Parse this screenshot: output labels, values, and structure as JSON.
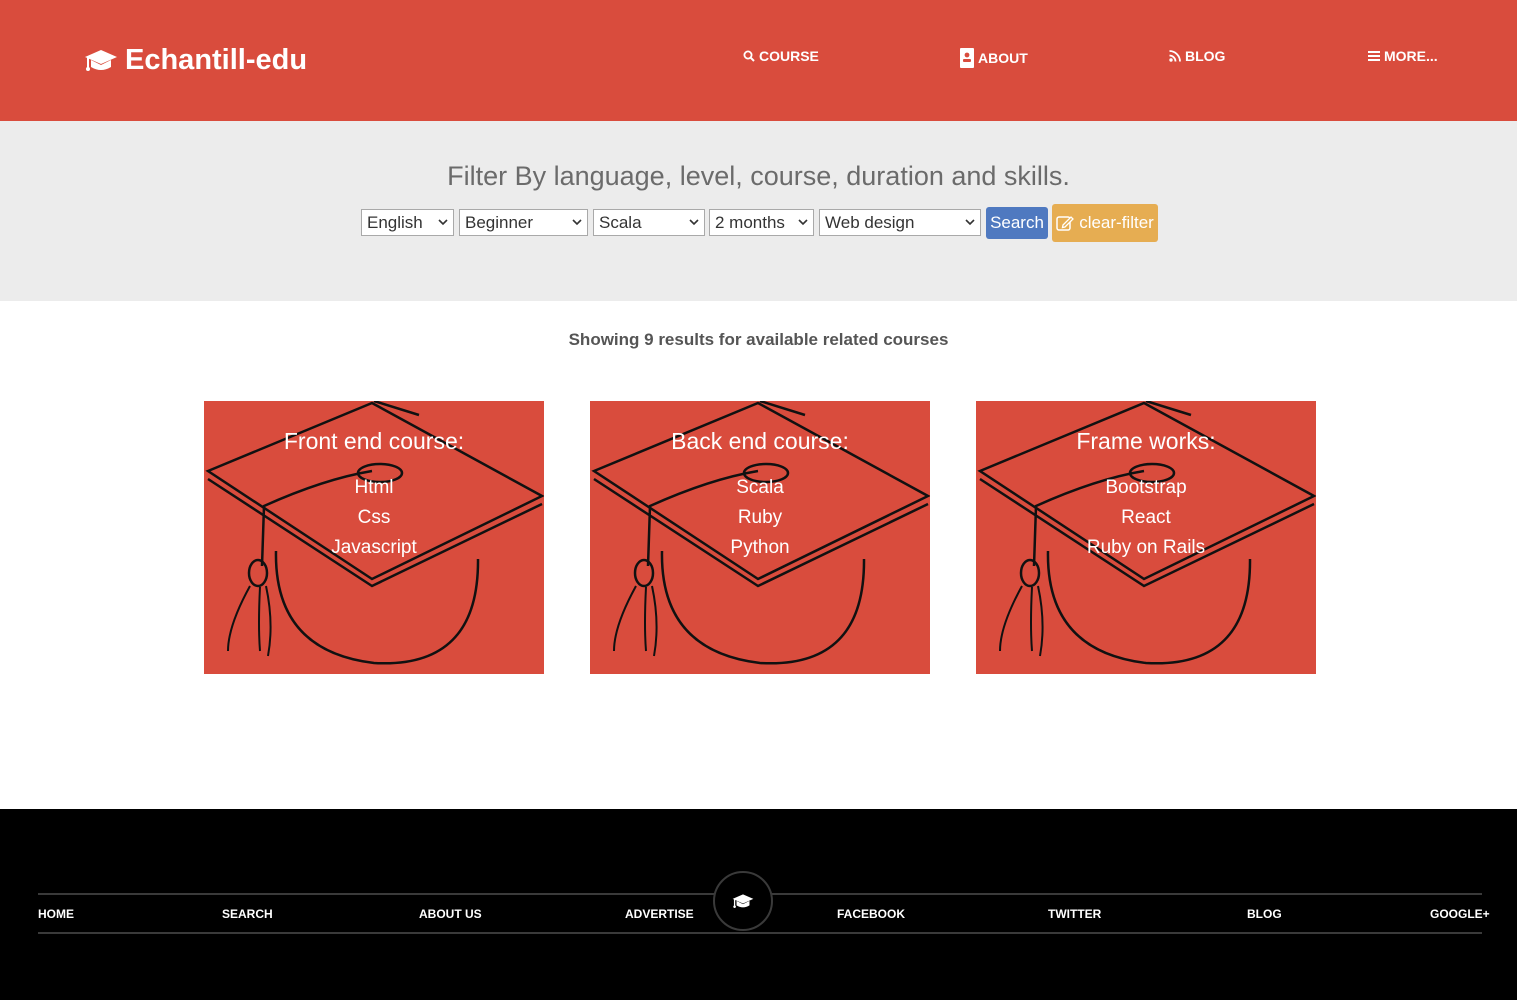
{
  "header": {
    "brand": "Echantill-edu",
    "nav": {
      "course": "COURSE",
      "about": "ABOUT",
      "blog": "BLOG",
      "more": "MORE..."
    }
  },
  "filter": {
    "title": "Filter By language, level, course, duration and skills.",
    "language": "English",
    "level": "Beginner",
    "course": "Scala",
    "duration": "2 months",
    "skill": "Web design",
    "search_label": "Search",
    "clear_label": "clear-filter"
  },
  "results": "Showing 9 results for available related courses",
  "cards": [
    {
      "title": "Front end course:",
      "items": [
        "Html",
        "Css",
        "Javascript"
      ]
    },
    {
      "title": "Back end course:",
      "items": [
        "Scala",
        "Ruby",
        "Python"
      ]
    },
    {
      "title": "Frame works:",
      "items": [
        "Bootstrap",
        "React",
        "Ruby on Rails"
      ]
    }
  ],
  "footer": {
    "links": [
      "HOME",
      "SEARCH",
      "ABOUT US",
      "ADVERTISE",
      "FACEBOOK",
      "TWITTER",
      "BLOG",
      "GOOGLE+"
    ]
  },
  "colors": {
    "header_bg": "#d94c3d",
    "filter_bg": "#ececec",
    "search_btn": "#4f79c0",
    "clear_btn": "#e6ad52",
    "footer_bg": "#000000"
  }
}
